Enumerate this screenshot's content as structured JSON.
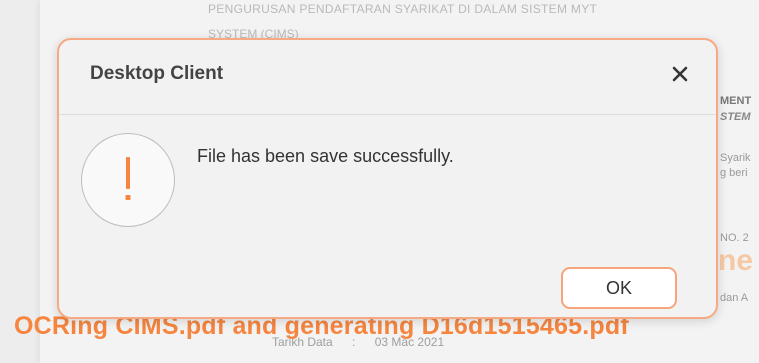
{
  "background": {
    "header_line1": "PENGURUSAN PENDAFTARAN SYARIKAT DI DALAM SISTEM MYT",
    "header_line2": "SYSTEM (CIMS)",
    "side_fragments": [
      "MENT",
      "STEM",
      "Syarik",
      "g beri",
      "NO. 2",
      "dan A"
    ],
    "orange_fragment": "ne",
    "date_label": "Tarikh Data",
    "date_separator": ":",
    "date_value": "03 Mac 2021"
  },
  "status_text": "OCRing CIMS.pdf and generating D16d1515465.pdf",
  "dialog": {
    "title": "Desktop Client",
    "close_icon": "close-icon",
    "warning_icon": "exclamation-icon",
    "message": "File has been save successfully.",
    "ok_label": "OK"
  },
  "colors": {
    "accent": "#f5853f",
    "dialog_border": "#f7a983",
    "dialog_bg": "#f2f2f2"
  }
}
